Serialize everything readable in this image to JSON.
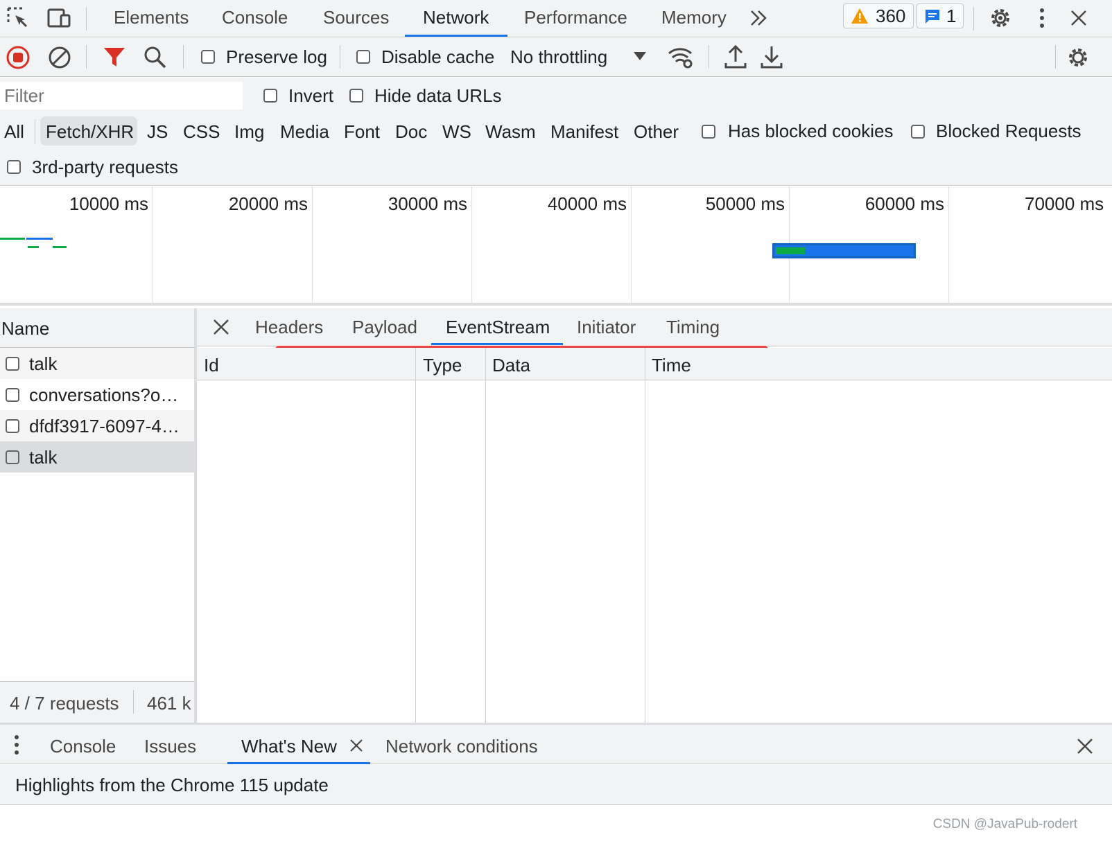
{
  "main_tabs": {
    "elements": "Elements",
    "console": "Console",
    "sources": "Sources",
    "network": "Network",
    "performance": "Performance",
    "memory": "Memory",
    "warning_count": "360",
    "message_count": "1"
  },
  "toolbar": {
    "preserve_log": "Preserve log",
    "disable_cache": "Disable cache",
    "throttling": "No throttling"
  },
  "filter": {
    "placeholder": "Filter",
    "invert": "Invert",
    "hide_data_urls": "Hide data URLs"
  },
  "type_filters": {
    "items": [
      "All",
      "Fetch/XHR",
      "JS",
      "CSS",
      "Img",
      "Media",
      "Font",
      "Doc",
      "WS",
      "Wasm",
      "Manifest",
      "Other"
    ],
    "selected": "Fetch/XHR",
    "has_blocked_cookies": "Has blocked cookies",
    "blocked_requests": "Blocked Requests",
    "third_party": "3rd-party requests"
  },
  "overview": {
    "ticks": [
      "10000 ms",
      "20000 ms",
      "30000 ms",
      "40000 ms",
      "50000 ms",
      "60000 ms",
      "70000 ms"
    ]
  },
  "requests": {
    "column_name": "Name",
    "rows": [
      "talk",
      "conversations?o…",
      "dfdf3917-6097-4…",
      "talk"
    ],
    "summary_count": "4 / 7 requests",
    "summary_size": "461 k"
  },
  "detail": {
    "tabs": [
      "Headers",
      "Payload",
      "EventStream",
      "Initiator",
      "Timing"
    ],
    "active_tab": "EventStream",
    "columns": [
      "Id",
      "Type",
      "Data",
      "Time"
    ]
  },
  "drawer": {
    "tabs": {
      "console": "Console",
      "issues": "Issues",
      "whats_new": "What's New",
      "network_conditions": "Network conditions"
    },
    "highlights": "Highlights from the Chrome 115 update"
  },
  "watermark": "CSDN @JavaPub-rodert",
  "colors": {
    "accent": "#1a73e8",
    "record": "#d93025",
    "filter_active": "#d93025",
    "annotation": "#ef4444",
    "warning": "#f29900",
    "waterfall_green": "#0ea947",
    "waterfall_blue": "#1a73e8"
  }
}
